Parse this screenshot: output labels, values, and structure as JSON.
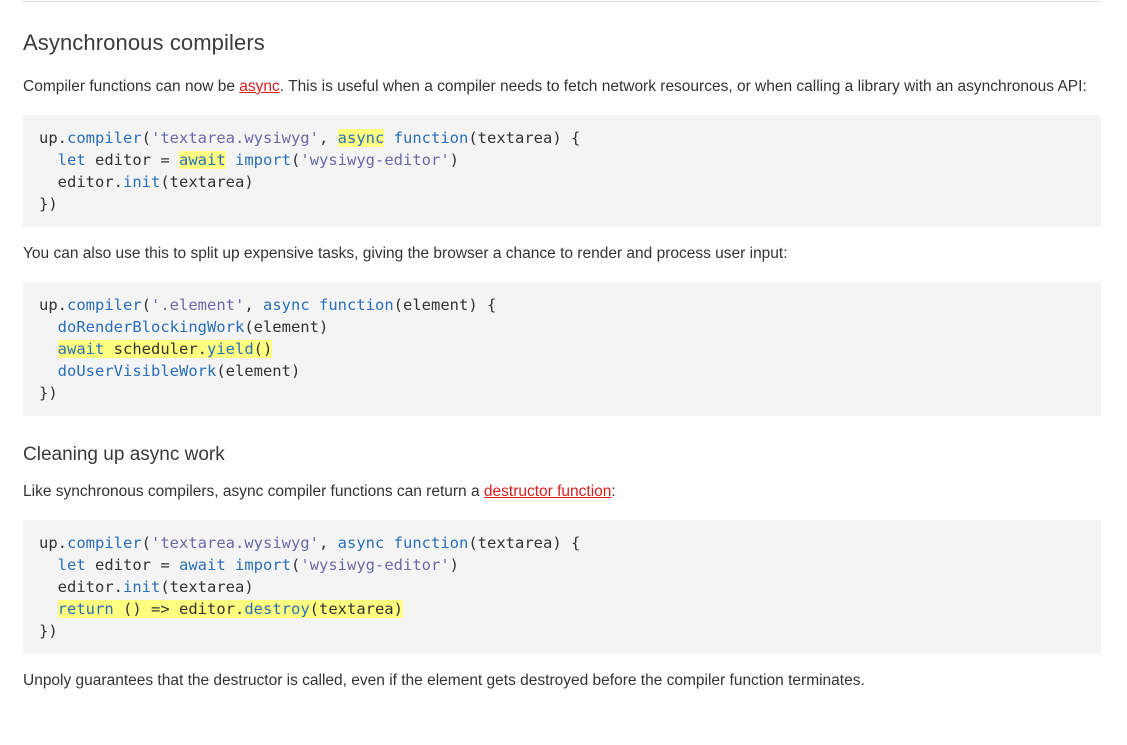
{
  "section": {
    "title": "Asynchronous compilers",
    "intro": {
      "before": "Compiler functions can now be ",
      "link": "async",
      "after": ". This is useful when a compiler needs to fetch network resources, or when calling a library with an asynchronous API:"
    },
    "code1": {
      "l1_a": "up.",
      "l1_b": "compiler",
      "l1_c": "(",
      "l1_d": "'textarea.wysiwyg'",
      "l1_e": ", ",
      "l1_f": "async",
      "l1_g": " ",
      "l1_h": "function",
      "l1_i": "(textarea) {",
      "l2_a": "  ",
      "l2_b": "let",
      "l2_c": " editor = ",
      "l2_d": "await",
      "l2_e": " ",
      "l2_f": "import",
      "l2_g": "(",
      "l2_h": "'wysiwyg-editor'",
      "l2_i": ")",
      "l3_a": "  editor.",
      "l3_b": "init",
      "l3_c": "(textarea)",
      "l4": "})"
    },
    "para2": "You can also use this to split up expensive tasks, giving the browser a chance to render and process user input:",
    "code2": {
      "l1_a": "up.",
      "l1_b": "compiler",
      "l1_c": "(",
      "l1_d": "'.element'",
      "l1_e": ", ",
      "l1_f": "async",
      "l1_g": " ",
      "l1_h": "function",
      "l1_i": "(element) {",
      "l2_a": "  ",
      "l2_b": "doRenderBlockingWork",
      "l2_c": "(element)",
      "l3_a": "  ",
      "l3_b": "await",
      "l3_c": " scheduler.",
      "l3_d": "yield",
      "l3_e": "()",
      "l4_a": "  ",
      "l4_b": "doUserVisibleWork",
      "l4_c": "(element)",
      "l5": "})"
    }
  },
  "subsection": {
    "title": "Cleaning up async work",
    "intro": {
      "before": "Like synchronous compilers, async compiler functions can return a ",
      "link": "destructor function",
      "after": ":"
    },
    "code3": {
      "l1_a": "up.",
      "l1_b": "compiler",
      "l1_c": "(",
      "l1_d": "'textarea.wysiwyg'",
      "l1_e": ", ",
      "l1_f": "async",
      "l1_g": " ",
      "l1_h": "function",
      "l1_i": "(textarea) {",
      "l2_a": "  ",
      "l2_b": "let",
      "l2_c": " editor = ",
      "l2_d": "await",
      "l2_e": " ",
      "l2_f": "import",
      "l2_g": "(",
      "l2_h": "'wysiwyg-editor'",
      "l2_i": ")",
      "l3_a": "  editor.",
      "l3_b": "init",
      "l3_c": "(textarea)",
      "l4_a": "  ",
      "l4_b": "return",
      "l4_c": " () => editor.",
      "l4_d": "destroy",
      "l4_e": "(textarea)",
      "l5": "})"
    },
    "outro": "Unpoly guarantees that the destructor is called, even if the element gets destroyed before the compiler function terminates."
  },
  "colors": {
    "link": "#d71e1e",
    "keyword": "#2a6fb8",
    "string": "#6a6aa8",
    "highlight": "#ffff80",
    "code_bg": "#f4f4f4"
  }
}
